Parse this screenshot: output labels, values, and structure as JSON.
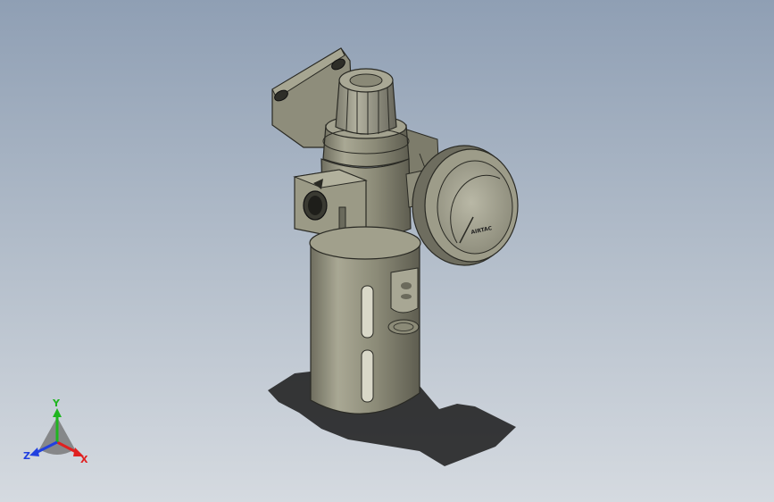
{
  "triad": {
    "x_label": "X",
    "y_label": "Y",
    "z_label": "Z",
    "colors": {
      "x": "#e02020",
      "y": "#1fb51f",
      "z": "#2040e0"
    }
  },
  "model": {
    "gauge_text": "AIRTAC"
  }
}
